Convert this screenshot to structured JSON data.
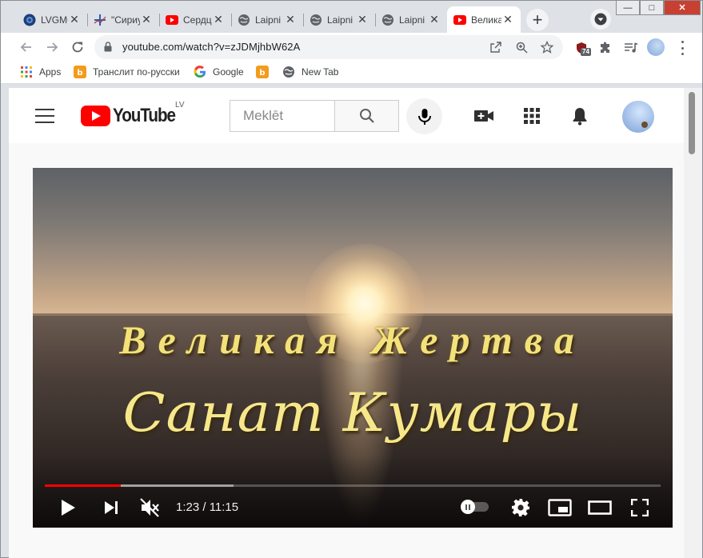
{
  "browser": {
    "tabs": [
      {
        "title": "LVGMC",
        "favicon": "globe-dark-icon"
      },
      {
        "title": "\"Сириус\"",
        "favicon": "plus-chart-icon"
      },
      {
        "title": "Сердце",
        "favicon": "youtube-icon"
      },
      {
        "title": "Laipni",
        "favicon": "globe-icon"
      },
      {
        "title": "Laipni",
        "favicon": "globe-icon"
      },
      {
        "title": "Laipni",
        "favicon": "globe-icon"
      },
      {
        "title": "Велика",
        "favicon": "youtube-icon",
        "active": true
      }
    ],
    "window_controls": {
      "minimize": "—",
      "maximize": "□",
      "close": "✕"
    },
    "url": "youtube.com/watch?v=zJDMjhbW62A",
    "extension_badge": "74",
    "bookmarks": [
      {
        "label": "Apps",
        "icon": "apps-grid-icon"
      },
      {
        "label": "Транслит по-русски",
        "icon": "translit-icon"
      },
      {
        "label": "Google",
        "icon": "google-icon"
      },
      {
        "label": "",
        "icon": "translit-icon"
      },
      {
        "label": "New Tab",
        "icon": "globe-icon"
      }
    ]
  },
  "youtube": {
    "logo_text": "YouTube",
    "country_code": "LV",
    "search_placeholder": "Meklēt",
    "accent_color": "#ff0000"
  },
  "player": {
    "title_line1": "Великая Жертва",
    "title_line2": "Санат Кумары",
    "time_display": "1:23 / 11:15",
    "played_fraction": 0.123,
    "buffered_fraction": 0.307,
    "muted": true,
    "autoplay_on": false
  }
}
